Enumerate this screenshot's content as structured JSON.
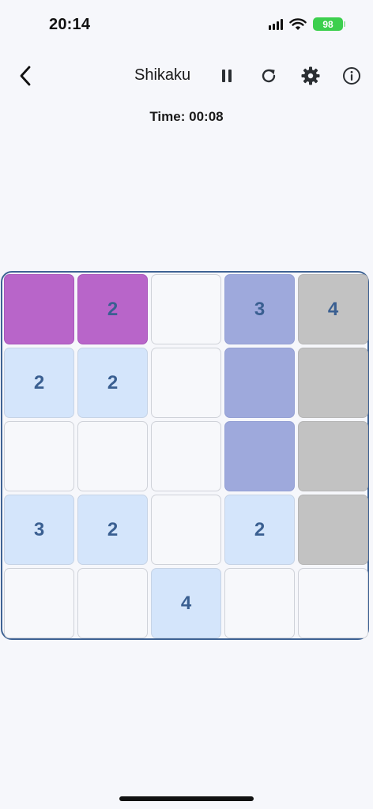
{
  "status_bar": {
    "time": "20:14",
    "battery": "98"
  },
  "header": {
    "title": "Shikaku",
    "icons": [
      "back-chevron",
      "pause",
      "reload",
      "gear",
      "info"
    ]
  },
  "timer": {
    "label": "Time:",
    "value": "00:08"
  },
  "board": {
    "rows": 5,
    "cols": 5,
    "cells": [
      [
        {
          "v": "",
          "s": "purple"
        },
        {
          "v": "2",
          "s": "purple"
        },
        {
          "v": "",
          "s": "empty"
        },
        {
          "v": "3",
          "s": "lavender"
        },
        {
          "v": "4",
          "s": "gray"
        }
      ],
      [
        {
          "v": "2",
          "s": "clue"
        },
        {
          "v": "2",
          "s": "clue"
        },
        {
          "v": "",
          "s": "empty"
        },
        {
          "v": "",
          "s": "lavender"
        },
        {
          "v": "",
          "s": "gray"
        }
      ],
      [
        {
          "v": "",
          "s": "empty"
        },
        {
          "v": "",
          "s": "empty"
        },
        {
          "v": "",
          "s": "empty"
        },
        {
          "v": "",
          "s": "lavender"
        },
        {
          "v": "",
          "s": "gray"
        }
      ],
      [
        {
          "v": "3",
          "s": "clue"
        },
        {
          "v": "2",
          "s": "clue"
        },
        {
          "v": "",
          "s": "empty"
        },
        {
          "v": "2",
          "s": "clue"
        },
        {
          "v": "",
          "s": "gray"
        }
      ],
      [
        {
          "v": "",
          "s": "empty"
        },
        {
          "v": "",
          "s": "empty"
        },
        {
          "v": "4",
          "s": "clue"
        },
        {
          "v": "",
          "s": "empty"
        },
        {
          "v": "",
          "s": "empty"
        }
      ]
    ]
  },
  "colors": {
    "purple": "#b865c9",
    "lavender": "#9ea9dc",
    "gray": "#c2c2c2",
    "clue": "#d4e5fb",
    "empty": "#f7f8fb",
    "number_text": "#3a5f91",
    "board_border": "#3f6394"
  }
}
